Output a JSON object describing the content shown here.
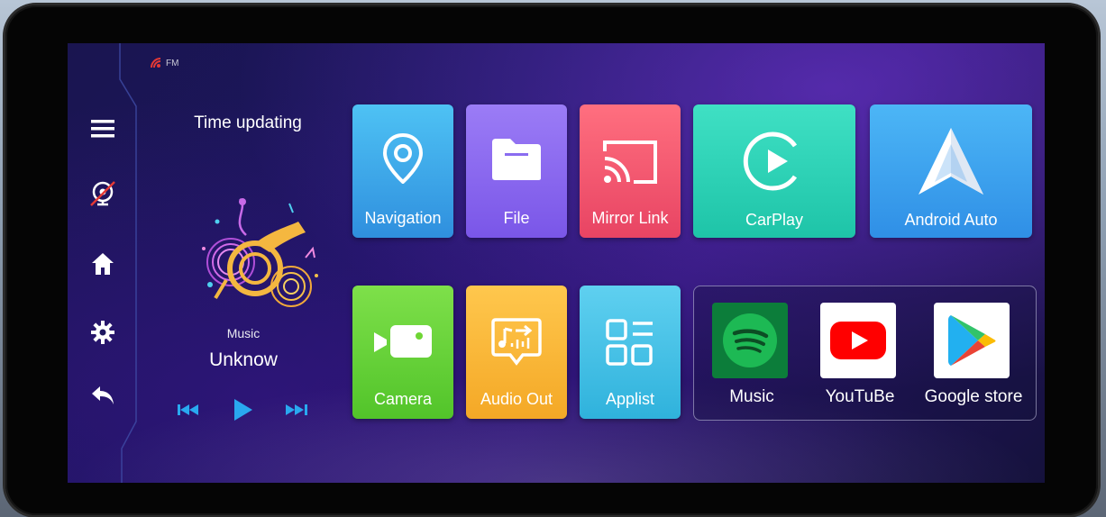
{
  "status": {
    "radio_label": "FM"
  },
  "sidebar": {
    "items": [
      {
        "icon": "menu-icon"
      },
      {
        "icon": "no-signal-icon"
      },
      {
        "icon": "home-icon"
      },
      {
        "icon": "gear-icon"
      },
      {
        "icon": "back-arrow-icon"
      }
    ]
  },
  "player": {
    "time_text": "Time updating",
    "source_label": "Music",
    "track_title": "Unknow"
  },
  "tiles": {
    "navigation": "Navigation",
    "file": "File",
    "mirror_link": "Mirror Link",
    "carplay": "CarPlay",
    "android_auto": "Android Auto",
    "camera": "Camera",
    "audio_out": "Audio Out",
    "applist": "Applist"
  },
  "apps": {
    "music": "Music",
    "youtube": "YouTuBe",
    "google_store": "Google store"
  },
  "colors": {
    "navigation": "#3fa9e8",
    "file": "#8a6cf0",
    "mirror_link": "#f0506a",
    "carplay": "#29d6b8",
    "android_auto": "#3aa6f0",
    "camera": "#6fd635",
    "audio_out": "#f7b83a",
    "applist": "#3ec0e0",
    "spotify": "#1db954",
    "youtube": "#ff0000"
  }
}
